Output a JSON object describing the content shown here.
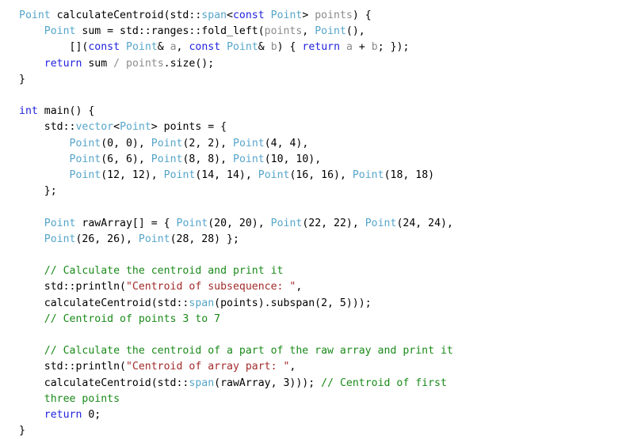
{
  "document": {
    "kind": "source-code-listing",
    "language": "C++",
    "background_color": "#ffffff"
  },
  "colors": {
    "keyword": "#2222dd",
    "type": "#56a5c9",
    "comment": "#1a8a1a",
    "string": "#a32b2b",
    "parameter": "#8b8b8b",
    "plain": "#000000"
  },
  "code": {
    "lines": [
      {
        "n": 1,
        "text": "Point calculateCentroid(std::span<const Point> points) {",
        "tokens": [
          {
            "t": "Point",
            "c": "typ"
          },
          {
            "t": " calculateCentroid(std::",
            "c": "pl"
          },
          {
            "t": "span",
            "c": "typ"
          },
          {
            "t": "<",
            "c": "pl"
          },
          {
            "t": "const",
            "c": "kw"
          },
          {
            "t": " ",
            "c": "pl"
          },
          {
            "t": "Point",
            "c": "typ"
          },
          {
            "t": "> ",
            "c": "pl"
          },
          {
            "t": "points",
            "c": "par"
          },
          {
            "t": ") {",
            "c": "pl"
          }
        ]
      },
      {
        "n": 2,
        "text": "    Point sum = std::ranges::fold_left(points, Point(),",
        "tokens": [
          {
            "t": "    ",
            "c": "pl"
          },
          {
            "t": "Point",
            "c": "typ"
          },
          {
            "t": " sum = std::ranges::fold_left(",
            "c": "pl"
          },
          {
            "t": "points",
            "c": "par"
          },
          {
            "t": ", ",
            "c": "pl"
          },
          {
            "t": "Point",
            "c": "typ"
          },
          {
            "t": "(),",
            "c": "pl"
          }
        ]
      },
      {
        "n": 3,
        "text": "        [](const Point& a, const Point& b) { return a + b; });",
        "tokens": [
          {
            "t": "        [](",
            "c": "pl"
          },
          {
            "t": "const",
            "c": "kw"
          },
          {
            "t": " ",
            "c": "pl"
          },
          {
            "t": "Point",
            "c": "typ"
          },
          {
            "t": "& ",
            "c": "pl"
          },
          {
            "t": "a",
            "c": "par"
          },
          {
            "t": ", ",
            "c": "pl"
          },
          {
            "t": "const",
            "c": "kw"
          },
          {
            "t": " ",
            "c": "pl"
          },
          {
            "t": "Point",
            "c": "typ"
          },
          {
            "t": "& ",
            "c": "pl"
          },
          {
            "t": "b",
            "c": "par"
          },
          {
            "t": ") { ",
            "c": "pl"
          },
          {
            "t": "return",
            "c": "kw"
          },
          {
            "t": " ",
            "c": "pl"
          },
          {
            "t": "a",
            "c": "par"
          },
          {
            "t": " + ",
            "c": "pl"
          },
          {
            "t": "b",
            "c": "par"
          },
          {
            "t": "; });",
            "c": "pl"
          }
        ]
      },
      {
        "n": 4,
        "text": "    return sum / points.size();",
        "tokens": [
          {
            "t": "    ",
            "c": "pl"
          },
          {
            "t": "return",
            "c": "kw"
          },
          {
            "t": " sum ",
            "c": "pl"
          },
          {
            "t": "/ ",
            "c": "par"
          },
          {
            "t": "points",
            "c": "par"
          },
          {
            "t": ".size();",
            "c": "pl"
          }
        ]
      },
      {
        "n": 5,
        "text": "}",
        "tokens": [
          {
            "t": "}",
            "c": "pl"
          }
        ]
      },
      {
        "n": 6,
        "text": "",
        "tokens": []
      },
      {
        "n": 7,
        "text": "int main() {",
        "tokens": [
          {
            "t": "int",
            "c": "kw"
          },
          {
            "t": " main() {",
            "c": "pl"
          }
        ]
      },
      {
        "n": 8,
        "text": "    std::vector<Point> points = {",
        "tokens": [
          {
            "t": "    std::",
            "c": "pl"
          },
          {
            "t": "vector",
            "c": "typ"
          },
          {
            "t": "<",
            "c": "pl"
          },
          {
            "t": "Point",
            "c": "typ"
          },
          {
            "t": "> points = {",
            "c": "pl"
          }
        ]
      },
      {
        "n": 9,
        "text": "        Point(0, 0), Point(2, 2), Point(4, 4),",
        "tokens": [
          {
            "t": "        ",
            "c": "pl"
          },
          {
            "t": "Point",
            "c": "typ"
          },
          {
            "t": "(0, 0), ",
            "c": "pl"
          },
          {
            "t": "Point",
            "c": "typ"
          },
          {
            "t": "(2, 2), ",
            "c": "pl"
          },
          {
            "t": "Point",
            "c": "typ"
          },
          {
            "t": "(4, 4),",
            "c": "pl"
          }
        ]
      },
      {
        "n": 10,
        "text": "        Point(6, 6), Point(8, 8), Point(10, 10),",
        "tokens": [
          {
            "t": "        ",
            "c": "pl"
          },
          {
            "t": "Point",
            "c": "typ"
          },
          {
            "t": "(6, 6), ",
            "c": "pl"
          },
          {
            "t": "Point",
            "c": "typ"
          },
          {
            "t": "(8, 8), ",
            "c": "pl"
          },
          {
            "t": "Point",
            "c": "typ"
          },
          {
            "t": "(10, 10),",
            "c": "pl"
          }
        ]
      },
      {
        "n": 11,
        "text": "        Point(12, 12), Point(14, 14), Point(16, 16), Point(18, 18)",
        "tokens": [
          {
            "t": "        ",
            "c": "pl"
          },
          {
            "t": "Point",
            "c": "typ"
          },
          {
            "t": "(12, 12), ",
            "c": "pl"
          },
          {
            "t": "Point",
            "c": "typ"
          },
          {
            "t": "(14, 14), ",
            "c": "pl"
          },
          {
            "t": "Point",
            "c": "typ"
          },
          {
            "t": "(16, 16), ",
            "c": "pl"
          },
          {
            "t": "Point",
            "c": "typ"
          },
          {
            "t": "(18, 18)",
            "c": "pl"
          }
        ]
      },
      {
        "n": 12,
        "text": "    };",
        "tokens": [
          {
            "t": "    };",
            "c": "pl"
          }
        ]
      },
      {
        "n": 13,
        "text": "",
        "tokens": []
      },
      {
        "n": 14,
        "text": "    Point rawArray[] = { Point(20, 20), Point(22, 22), Point(24, 24),",
        "tokens": [
          {
            "t": "    ",
            "c": "pl"
          },
          {
            "t": "Point",
            "c": "typ"
          },
          {
            "t": " rawArray[] = { ",
            "c": "pl"
          },
          {
            "t": "Point",
            "c": "typ"
          },
          {
            "t": "(20, 20), ",
            "c": "pl"
          },
          {
            "t": "Point",
            "c": "typ"
          },
          {
            "t": "(22, 22), ",
            "c": "pl"
          },
          {
            "t": "Point",
            "c": "typ"
          },
          {
            "t": "(24, 24),",
            "c": "pl"
          }
        ]
      },
      {
        "n": 15,
        "text": "    Point(26, 26), Point(28, 28) };",
        "tokens": [
          {
            "t": "    ",
            "c": "pl"
          },
          {
            "t": "Point",
            "c": "typ"
          },
          {
            "t": "(26, 26), ",
            "c": "pl"
          },
          {
            "t": "Point",
            "c": "typ"
          },
          {
            "t": "(28, 28) };",
            "c": "pl"
          }
        ]
      },
      {
        "n": 16,
        "text": "",
        "tokens": []
      },
      {
        "n": 17,
        "text": "    // Calculate the centroid and print it",
        "tokens": [
          {
            "t": "    ",
            "c": "pl"
          },
          {
            "t": "// Calculate the centroid and print it",
            "c": "cmt"
          }
        ]
      },
      {
        "n": 18,
        "text": "    std::println(\"Centroid of subsequence: \",",
        "tokens": [
          {
            "t": "    std::println(",
            "c": "pl"
          },
          {
            "t": "\"Centroid of subsequence: \"",
            "c": "str"
          },
          {
            "t": ",",
            "c": "pl"
          }
        ]
      },
      {
        "n": 19,
        "text": "    calculateCentroid(std::span(points).subspan(2, 5)));",
        "tokens": [
          {
            "t": "    calculateCentroid(std::",
            "c": "pl"
          },
          {
            "t": "span",
            "c": "typ"
          },
          {
            "t": "(points).subspan(2, 5)));",
            "c": "pl"
          }
        ]
      },
      {
        "n": 20,
        "text": "    // Centroid of points 3 to 7",
        "tokens": [
          {
            "t": "    ",
            "c": "pl"
          },
          {
            "t": "// Centroid of points 3 to 7",
            "c": "cmt"
          }
        ]
      },
      {
        "n": 21,
        "text": "",
        "tokens": []
      },
      {
        "n": 22,
        "text": "    // Calculate the centroid of a part of the raw array and print it",
        "tokens": [
          {
            "t": "    ",
            "c": "pl"
          },
          {
            "t": "// Calculate the centroid of a part of the raw array and print it",
            "c": "cmt"
          }
        ]
      },
      {
        "n": 23,
        "text": "    std::println(\"Centroid of array part: \",",
        "tokens": [
          {
            "t": "    std::println(",
            "c": "pl"
          },
          {
            "t": "\"Centroid of array part: \"",
            "c": "str"
          },
          {
            "t": ",",
            "c": "pl"
          }
        ]
      },
      {
        "n": 24,
        "text": "    calculateCentroid(std::span(rawArray, 3))); // Centroid of first",
        "tokens": [
          {
            "t": "    calculateCentroid(std::",
            "c": "pl"
          },
          {
            "t": "span",
            "c": "typ"
          },
          {
            "t": "(rawArray, 3))); ",
            "c": "pl"
          },
          {
            "t": "// Centroid of first",
            "c": "cmt"
          }
        ]
      },
      {
        "n": 25,
        "text": "    three points",
        "tokens": [
          {
            "t": "    ",
            "c": "pl"
          },
          {
            "t": "three points",
            "c": "cmt"
          }
        ]
      },
      {
        "n": 26,
        "text": "    return 0;",
        "tokens": [
          {
            "t": "    ",
            "c": "pl"
          },
          {
            "t": "return",
            "c": "kw"
          },
          {
            "t": " 0;",
            "c": "pl"
          }
        ]
      },
      {
        "n": 27,
        "text": "}",
        "tokens": [
          {
            "t": "}",
            "c": "pl"
          }
        ]
      }
    ]
  }
}
